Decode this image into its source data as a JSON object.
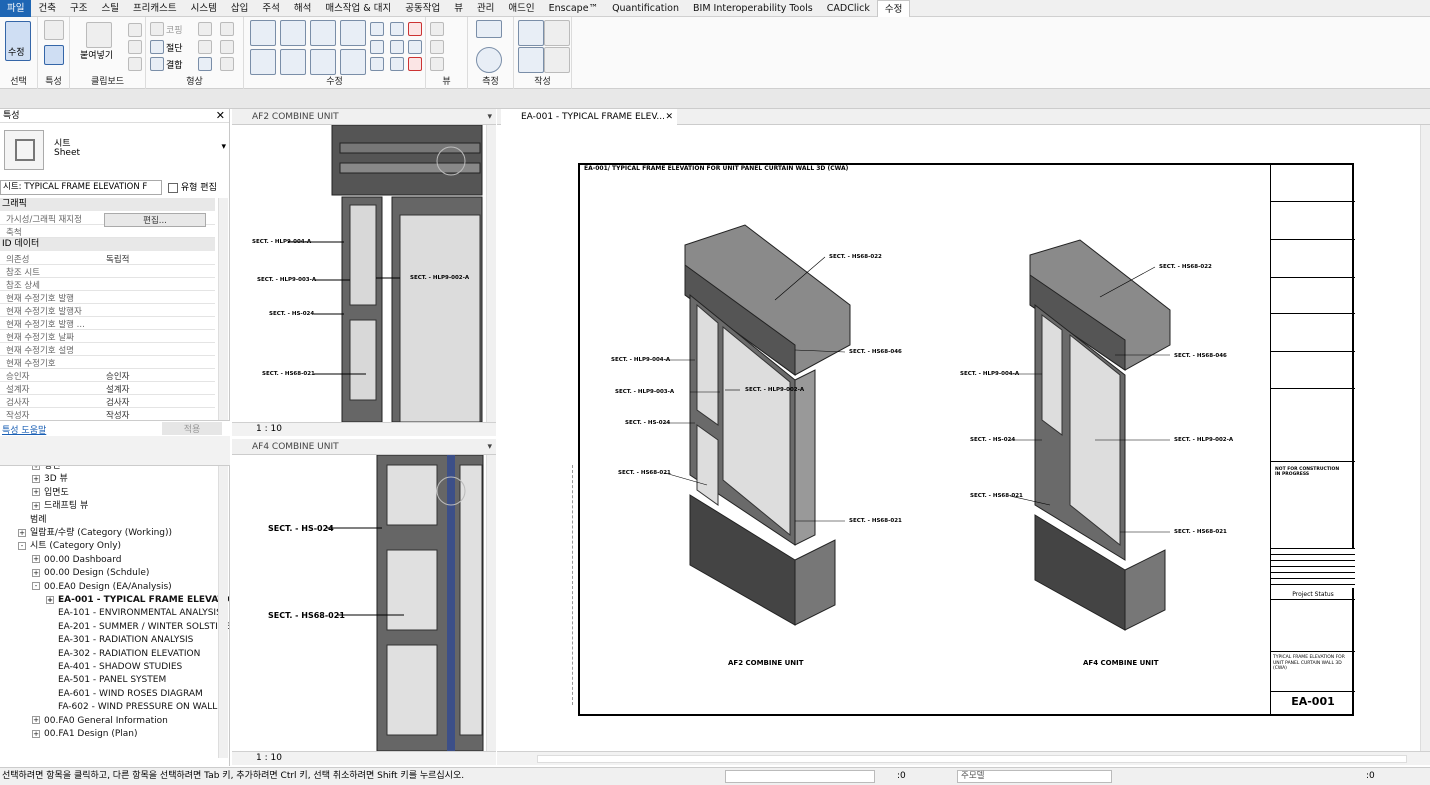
{
  "menu_tabs": [
    "파일",
    "건축",
    "구조",
    "스틸",
    "프리캐스트",
    "시스템",
    "삽입",
    "주석",
    "해석",
    "매스작업 & 대지",
    "공동작업",
    "뷰",
    "관리",
    "애드인",
    "Enscape™",
    "Quantification",
    "BIM Interoperability Tools",
    "CADClick",
    "수정"
  ],
  "ribbon": {
    "select_btn": "수정",
    "panels": [
      "선택",
      "특성",
      "클립보드",
      "형상",
      "수정",
      "뷰",
      "측정",
      "작성"
    ],
    "paste_label": "붙여넣기",
    "geom_items": [
      "코핑",
      "절단",
      "결합"
    ]
  },
  "properties": {
    "title": "특성",
    "type_name_ko": "시트",
    "type_name_en": "Sheet",
    "selector": "시트: TYPICAL FRAME ELEVATION F",
    "edit_type": "유형 편집",
    "sections": [
      {
        "name": "그래픽",
        "rows": [
          {
            "k": "가시성/그래픽 재지정",
            "v": "편집..."
          },
          {
            "k": "축척",
            "v": ""
          }
        ]
      },
      {
        "name": "ID 데이터",
        "rows": [
          {
            "k": "의존성",
            "v": "독립적"
          },
          {
            "k": "참조 시트",
            "v": ""
          },
          {
            "k": "참조 상세",
            "v": ""
          },
          {
            "k": "현재 수정기호 발행",
            "v": ""
          },
          {
            "k": "현재 수정기호 발행자",
            "v": ""
          },
          {
            "k": "현재 수정기호 발행 ...",
            "v": ""
          },
          {
            "k": "현재 수정기호 날짜",
            "v": ""
          },
          {
            "k": "현재 수정기호 설명",
            "v": ""
          },
          {
            "k": "현재 수정기호",
            "v": ""
          },
          {
            "k": "승인자",
            "v": "승인자"
          },
          {
            "k": "설계자",
            "v": "설계자"
          },
          {
            "k": "검사자",
            "v": "검사자"
          },
          {
            "k": "작성자",
            "v": "작성자"
          }
        ]
      }
    ],
    "help_link": "특성 도움말",
    "apply": "적용"
  },
  "browser": {
    "items": [
      {
        "t": "평면",
        "lvl": 1,
        "exp": "+"
      },
      {
        "t": "3D 뷰",
        "lvl": 1,
        "exp": "+"
      },
      {
        "t": "입면도",
        "lvl": 1,
        "exp": "+"
      },
      {
        "t": "드래프팅 뷰",
        "lvl": 1,
        "exp": "+"
      },
      {
        "t": "범례",
        "lvl": 0,
        "exp": ""
      },
      {
        "t": "일람표/수량 (Category (Working))",
        "lvl": 0,
        "exp": "+"
      },
      {
        "t": "시트 (Category Only)",
        "lvl": 0,
        "exp": "-"
      },
      {
        "t": "00.00 Dashboard",
        "lvl": 1,
        "exp": "+"
      },
      {
        "t": "00.00 Design (Schdule)",
        "lvl": 1,
        "exp": "+"
      },
      {
        "t": "00.EA0 Design (EA/Analysis)",
        "lvl": 1,
        "exp": "-"
      },
      {
        "t": "EA-001 - TYPICAL FRAME ELEVATION F",
        "lvl": 2,
        "exp": "+",
        "bold": true
      },
      {
        "t": "EA-101 - ENVIRONMENTAL ANALYSIS",
        "lvl": 2,
        "exp": ""
      },
      {
        "t": "EA-201 - SUMMER / WINTER SOLSTICE",
        "lvl": 2,
        "exp": ""
      },
      {
        "t": "EA-301 - RADIATION ANALYSIS",
        "lvl": 2,
        "exp": ""
      },
      {
        "t": "EA-302 - RADIATION ELEVATION",
        "lvl": 2,
        "exp": ""
      },
      {
        "t": "EA-401 - SHADOW STUDIES",
        "lvl": 2,
        "exp": ""
      },
      {
        "t": "EA-501 - PANEL SYSTEM",
        "lvl": 2,
        "exp": ""
      },
      {
        "t": "EA-601 - WIND ROSES DIAGRAM",
        "lvl": 2,
        "exp": ""
      },
      {
        "t": "FA-602 - WIND PRESSURE ON WALL",
        "lvl": 2,
        "exp": ""
      },
      {
        "t": "00.FA0 General Information",
        "lvl": 1,
        "exp": "+"
      },
      {
        "t": "00.FA1 Design (Plan)",
        "lvl": 1,
        "exp": "+"
      }
    ]
  },
  "views": {
    "af2_tab": "AF2 COMBINE UNIT",
    "af4_tab": "AF4 COMBINE UNIT",
    "sheet_tab": "EA-001 - TYPICAL FRAME ELEV...",
    "scale1": "1 : 10",
    "scale2": "1 : 10",
    "af2_labels": [
      "SECT. - HLP9-004-A",
      "SECT. - HLP9-003-A",
      "SECT. - HLP9-002-A",
      "SECT. - HS-024",
      "SECT. - HS68-021"
    ],
    "af4_labels": [
      "SECT. - HS-024",
      "SECT. - HS68-021"
    ]
  },
  "sheet": {
    "title": "EA-001/ TYPICAL FRAME ELEVATION FOR UNIT PANEL CURTAIN WALL 3D (CWA)",
    "left_caption": "AF2 COMBINE UNIT",
    "right_caption": "AF4 COMBINE UNIT",
    "left_labels": [
      "SECT. - HS68-022",
      "SECT. - HS68-046",
      "SECT. - HLP9-004-A",
      "SECT. - HLP9-003-A",
      "SECT. - HLP9-002-A",
      "SECT. - HS-024",
      "SECT. - HS68-021",
      "SECT. - HS68-021"
    ],
    "right_labels": [
      "SECT. - HS68-022",
      "SECT. - HS68-046",
      "SECT. - HLP9-004-A",
      "SECT. - HS-024",
      "SECT. - HLP9-002-A",
      "SECT. - HS68-021",
      "SECT. - HS68-021"
    ],
    "tb_note": "NOT FOR CONSTRUCTION IN PROGRESS",
    "tb_status": "Project Status",
    "tb_desc": "TYPICAL FRAME ELEVATION FOR UNIT PANEL CURTAIN WALL 3D (CWA)",
    "sheet_no": "EA-001"
  },
  "status_bar": {
    "hint": "선택하려면 항목을 클릭하고, 다른 항목을 선택하려면 Tab 키, 추가하려면 Ctrl 키, 선택 취소하려면 Shift 키를 누르십시오.",
    "count1": ":0",
    "model": "주모델",
    "count2": ":0"
  }
}
